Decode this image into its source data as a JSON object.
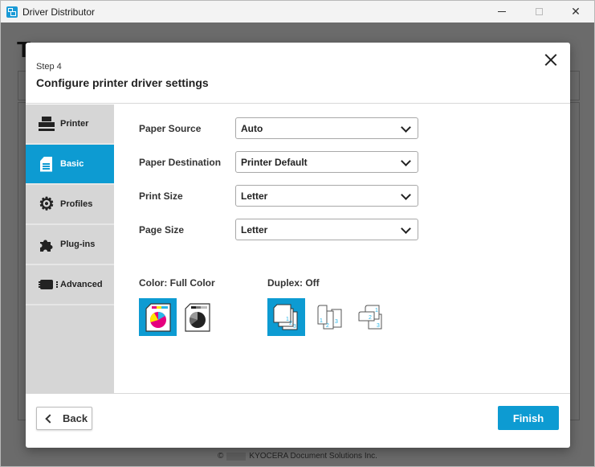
{
  "window": {
    "title": "Driver Distributor",
    "icon": "driver-distributor-app-icon",
    "controls": {
      "minimize": "minimize",
      "maximize": "maximize",
      "close": "✕"
    }
  },
  "background": {
    "title_initial": "T",
    "footer": {
      "copyright": "©",
      "company": "KYOCERA Document Solutions Inc."
    }
  },
  "dialog": {
    "step": "Step 4",
    "title": "Configure printer driver settings",
    "close_icon": "close-icon",
    "sidebar": {
      "items": [
        {
          "label": "Printer",
          "icon": "printer-icon",
          "active": false
        },
        {
          "label": "Basic",
          "icon": "document-icon",
          "active": true
        },
        {
          "label": "Profiles",
          "icon": "gear-icon",
          "active": false
        },
        {
          "label": "Plug-ins",
          "icon": "puzzle-icon",
          "active": false
        },
        {
          "label": "Advanced",
          "icon": "chip-icon",
          "active": false
        }
      ]
    },
    "fields": [
      {
        "label": "Paper Source",
        "value": "Auto"
      },
      {
        "label": "Paper Destination",
        "value": "Printer Default"
      },
      {
        "label": "Print Size",
        "value": "Letter"
      },
      {
        "label": "Page Size",
        "value": "Letter"
      }
    ],
    "color": {
      "title": "Color: Full Color",
      "options": [
        {
          "name": "full-color",
          "selected": true
        },
        {
          "name": "black-and-white",
          "selected": false
        }
      ]
    },
    "duplex": {
      "title": "Duplex: Off",
      "options": [
        {
          "name": "off",
          "selected": true,
          "page_numbers": [
            "1",
            "2",
            "3"
          ]
        },
        {
          "name": "long-edge",
          "selected": false,
          "page_numbers": [
            "1",
            "2",
            "3"
          ]
        },
        {
          "name": "short-edge",
          "selected": false,
          "page_numbers": [
            "1",
            "2",
            "3"
          ]
        }
      ]
    },
    "footer": {
      "back_label": "Back",
      "finish_label": "Finish"
    },
    "colors": {
      "accent": "#0d9bd2",
      "sidebar_bg": "#d6d6d6",
      "cyan": "#29b6e8",
      "magenta": "#e5007e",
      "yellow": "#ffe600"
    }
  }
}
